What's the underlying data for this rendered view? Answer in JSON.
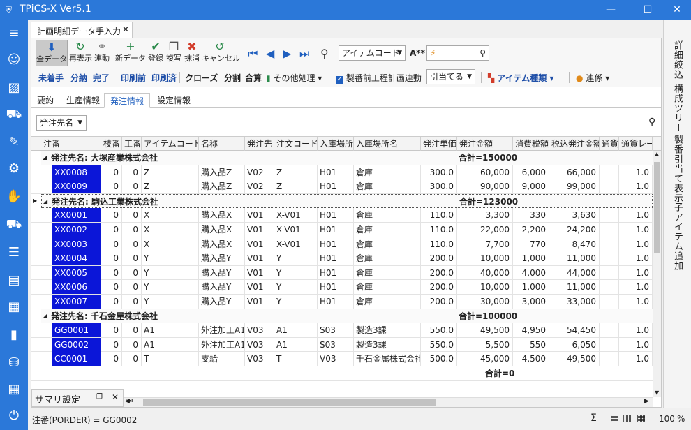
{
  "window": {
    "title": "TPiCS-X Ver5.1",
    "app_icon": "shield-icon",
    "min": "—",
    "max": "☐",
    "close": "✕"
  },
  "leftbar": {
    "icons": [
      "hamburger-menu-icon",
      "robot-icon",
      "chart-card-icon",
      "forklift-icon",
      "wrench-icon",
      "conveyor-icon",
      "handshake-icon",
      "truck-icon",
      "coins-icon",
      "archive-box-icon",
      "building-icon",
      "bar-chart-icon",
      "database-gear-icon",
      "factory-icon",
      "power-icon"
    ]
  },
  "doc_tab": {
    "label": "計画明細データ手入力",
    "close": "✕"
  },
  "toolbar1": {
    "all_data": "全データ",
    "redisplay": "再表示",
    "link": "連動",
    "new_data": "新データ",
    "register": "登録",
    "copy": "複写",
    "delete": "抹消",
    "cancel": "キャンセル",
    "search_field": "アイテムコード",
    "font_label": "A**",
    "search_value": "⚡"
  },
  "toolbar2": {
    "not_started": "未着手",
    "partial": "分納",
    "done": "完了",
    "printed_before": "印刷前",
    "printed": "印刷済",
    "close": "クローズ",
    "split": "分割",
    "merge": "合算",
    "other": "その他処理",
    "chk_label": "製番前工程計画連動",
    "combo": "引当てる",
    "item_type": "アイテム種類",
    "relation": "連係"
  },
  "tabs": [
    "要約",
    "生産情報",
    "発注情報",
    "設定情報"
  ],
  "filter": {
    "value": "発注先名"
  },
  "columns": [
    "注番",
    "枝番",
    "工番",
    "アイテムコード",
    "名称",
    "発注先",
    "注文コード",
    "入庫場所",
    "入庫場所名",
    "発注単価",
    "発注金額",
    "消費税額",
    "税込発注金額",
    "通貨",
    "通貨レー"
  ],
  "groups": [
    {
      "title": "発注先名: 大塚産業株式会社",
      "sum": "合計=150000",
      "rows": [
        [
          "XX0008",
          "0",
          "0",
          "Z",
          "購入品Z",
          "V02",
          "Z",
          "H01",
          "倉庫",
          "300.0",
          "60,000",
          "6,000",
          "66,000",
          "",
          "1.0"
        ],
        [
          "XX0009",
          "0",
          "0",
          "Z",
          "購入品Z",
          "V02",
          "Z",
          "H01",
          "倉庫",
          "300.0",
          "90,000",
          "9,000",
          "99,000",
          "",
          "1.0"
        ]
      ]
    },
    {
      "title": "発注先名: 駒込工業株式会社",
      "sum": "合計=123000",
      "rows": [
        [
          "XX0001",
          "0",
          "0",
          "X",
          "購入品X",
          "V01",
          "X-V01",
          "H01",
          "倉庫",
          "110.0",
          "3,300",
          "330",
          "3,630",
          "",
          "1.0"
        ],
        [
          "XX0002",
          "0",
          "0",
          "X",
          "購入品X",
          "V01",
          "X-V01",
          "H01",
          "倉庫",
          "110.0",
          "22,000",
          "2,200",
          "24,200",
          "",
          "1.0"
        ],
        [
          "XX0003",
          "0",
          "0",
          "X",
          "購入品X",
          "V01",
          "X-V01",
          "H01",
          "倉庫",
          "110.0",
          "7,700",
          "770",
          "8,470",
          "",
          "1.0"
        ],
        [
          "XX0004",
          "0",
          "0",
          "Y",
          "購入品Y",
          "V01",
          "Y",
          "H01",
          "倉庫",
          "200.0",
          "10,000",
          "1,000",
          "11,000",
          "",
          "1.0"
        ],
        [
          "XX0005",
          "0",
          "0",
          "Y",
          "購入品Y",
          "V01",
          "Y",
          "H01",
          "倉庫",
          "200.0",
          "40,000",
          "4,000",
          "44,000",
          "",
          "1.0"
        ],
        [
          "XX0006",
          "0",
          "0",
          "Y",
          "購入品Y",
          "V01",
          "Y",
          "H01",
          "倉庫",
          "200.0",
          "10,000",
          "1,000",
          "11,000",
          "",
          "1.0"
        ],
        [
          "XX0007",
          "0",
          "0",
          "Y",
          "購入品Y",
          "V01",
          "Y",
          "H01",
          "倉庫",
          "200.0",
          "30,000",
          "3,000",
          "33,000",
          "",
          "1.0"
        ]
      ]
    },
    {
      "title": "発注先名: 千石金屋株式会社",
      "sum": "合計=100000",
      "rows": [
        [
          "GG0001",
          "0",
          "0",
          "A1",
          "外注加工A1",
          "V03",
          "A1",
          "S03",
          "製造3課",
          "550.0",
          "49,500",
          "4,950",
          "54,450",
          "",
          "1.0"
        ],
        [
          "GG0002",
          "0",
          "0",
          "A1",
          "外注加工A1",
          "V03",
          "A1",
          "S03",
          "製造3課",
          "550.0",
          "5,500",
          "550",
          "6,050",
          "",
          "1.0"
        ],
        [
          "CC0001",
          "0",
          "0",
          "T",
          "支給",
          "V03",
          "T",
          "V03",
          "千石金属株式会社",
          "500.0",
          "45,000",
          "4,500",
          "49,500",
          "",
          "1.0"
        ]
      ]
    }
  ],
  "footer_sum": "合計=0",
  "summary_panel": {
    "title": "サマリ設定"
  },
  "rightbar": [
    "詳細絞込",
    "構成ツリー",
    "製番引当て表示",
    "子アイテム追加"
  ],
  "status": {
    "text": "注番(PORDER) = GG0002",
    "zoom": "100",
    "pct": "%"
  }
}
